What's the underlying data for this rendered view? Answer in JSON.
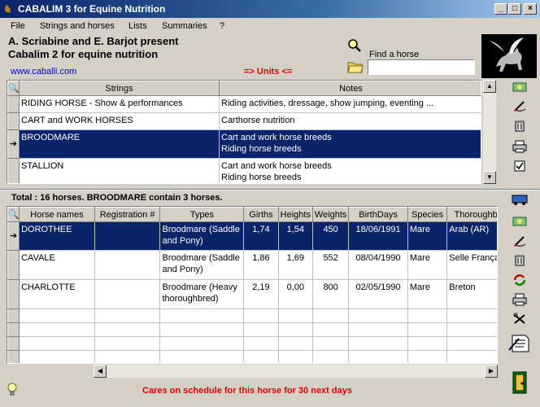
{
  "window": {
    "title": "CABALIM 3 for Equine Nutrition",
    "icon": "horse-icon"
  },
  "menu": {
    "file": "File",
    "strings_horses": "Strings and horses",
    "lists": "Lists",
    "summaries": "Summaries",
    "help": "?"
  },
  "header": {
    "line1": "A. Scriabine and E. Barjot present",
    "line2": "Cabalim 2 for equine nutrition",
    "url": "www.caballi.com",
    "units_link": "=> Units <=",
    "find_label": "Find a horse",
    "find_value": ""
  },
  "strings_table": {
    "columns": [
      "Strings",
      "Notes"
    ],
    "rows": [
      {
        "string": "RIDING HORSE - Show & performances",
        "notes": "Riding activities, dressage, show jumping, eventing ...",
        "notes2": ""
      },
      {
        "string": "CART and WORK HORSES",
        "notes": "Carthorse nutrition",
        "notes2": ""
      },
      {
        "string": "BROODMARE",
        "notes": "Cart and work horse breeds",
        "notes2": "Riding horse breeds",
        "selected": true
      },
      {
        "string": "STALLION",
        "notes": "Cart and work horse breeds",
        "notes2": "Riding horse breeds"
      }
    ]
  },
  "total_text": "Total : 16 horses. BROODMARE contain 3 horses.",
  "horses_table": {
    "columns": [
      "Horse names",
      "Registration #",
      "Types",
      "Girths",
      "Heights",
      "Weights",
      "BirthDays",
      "Species",
      "Thoroughbred"
    ],
    "rows": [
      {
        "name": "DOROTHEE",
        "reg": "",
        "type": "Broodmare (Saddle and Pony)",
        "girth": "1,74",
        "height": "1,54",
        "weight": "450",
        "birth": "18/06/1991",
        "species": "Mare",
        "breed": "Arab (AR)",
        "selected": true
      },
      {
        "name": "CAVALE",
        "reg": "",
        "type": "Broodmare (Saddle and Pony)",
        "girth": "1,86",
        "height": "1,69",
        "weight": "552",
        "birth": "08/04/1990",
        "species": "Mare",
        "breed": "Selle Français"
      },
      {
        "name": "CHARLOTTE",
        "reg": "",
        "type": "Broodmare (Heavy thoroughbred)",
        "girth": "2,19",
        "height": "0,00",
        "weight": "800",
        "birth": "02/05/1990",
        "species": "Mare",
        "breed": "Breton"
      }
    ]
  },
  "status_text": "Cares on schedule for this horse for 30 next days",
  "icons": {
    "search": "magnifier-icon",
    "folder": "folder-icon",
    "logo": "pegasus-logo"
  },
  "colors": {
    "selection": "#0a246a",
    "status_red": "#e00000",
    "link_blue": "#0000cc"
  }
}
